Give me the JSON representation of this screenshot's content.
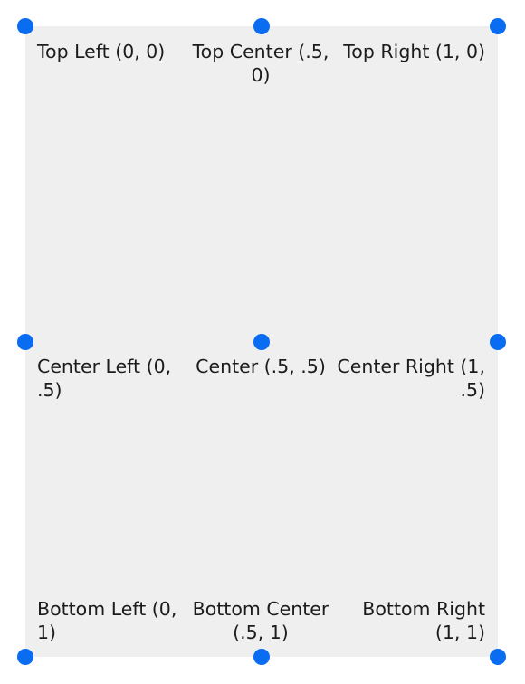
{
  "colors": {
    "background": "#efefef",
    "dot": "#0a6cf1",
    "text": "#1c1c1e"
  },
  "labels": {
    "top_left": "Top Left (0, 0)",
    "top_center": "Top Center (.5, 0)",
    "top_right": "Top Right (1, 0)",
    "center_left": "Center Left (0, .5)",
    "center": "Center (.5, .5)",
    "center_right": "Center Right (1, .5)",
    "bottom_left": "Bottom Left (0, 1)",
    "bottom_center": "Bottom Center (.5, 1)",
    "bottom_right": "Bottom Right (1, 1)"
  }
}
